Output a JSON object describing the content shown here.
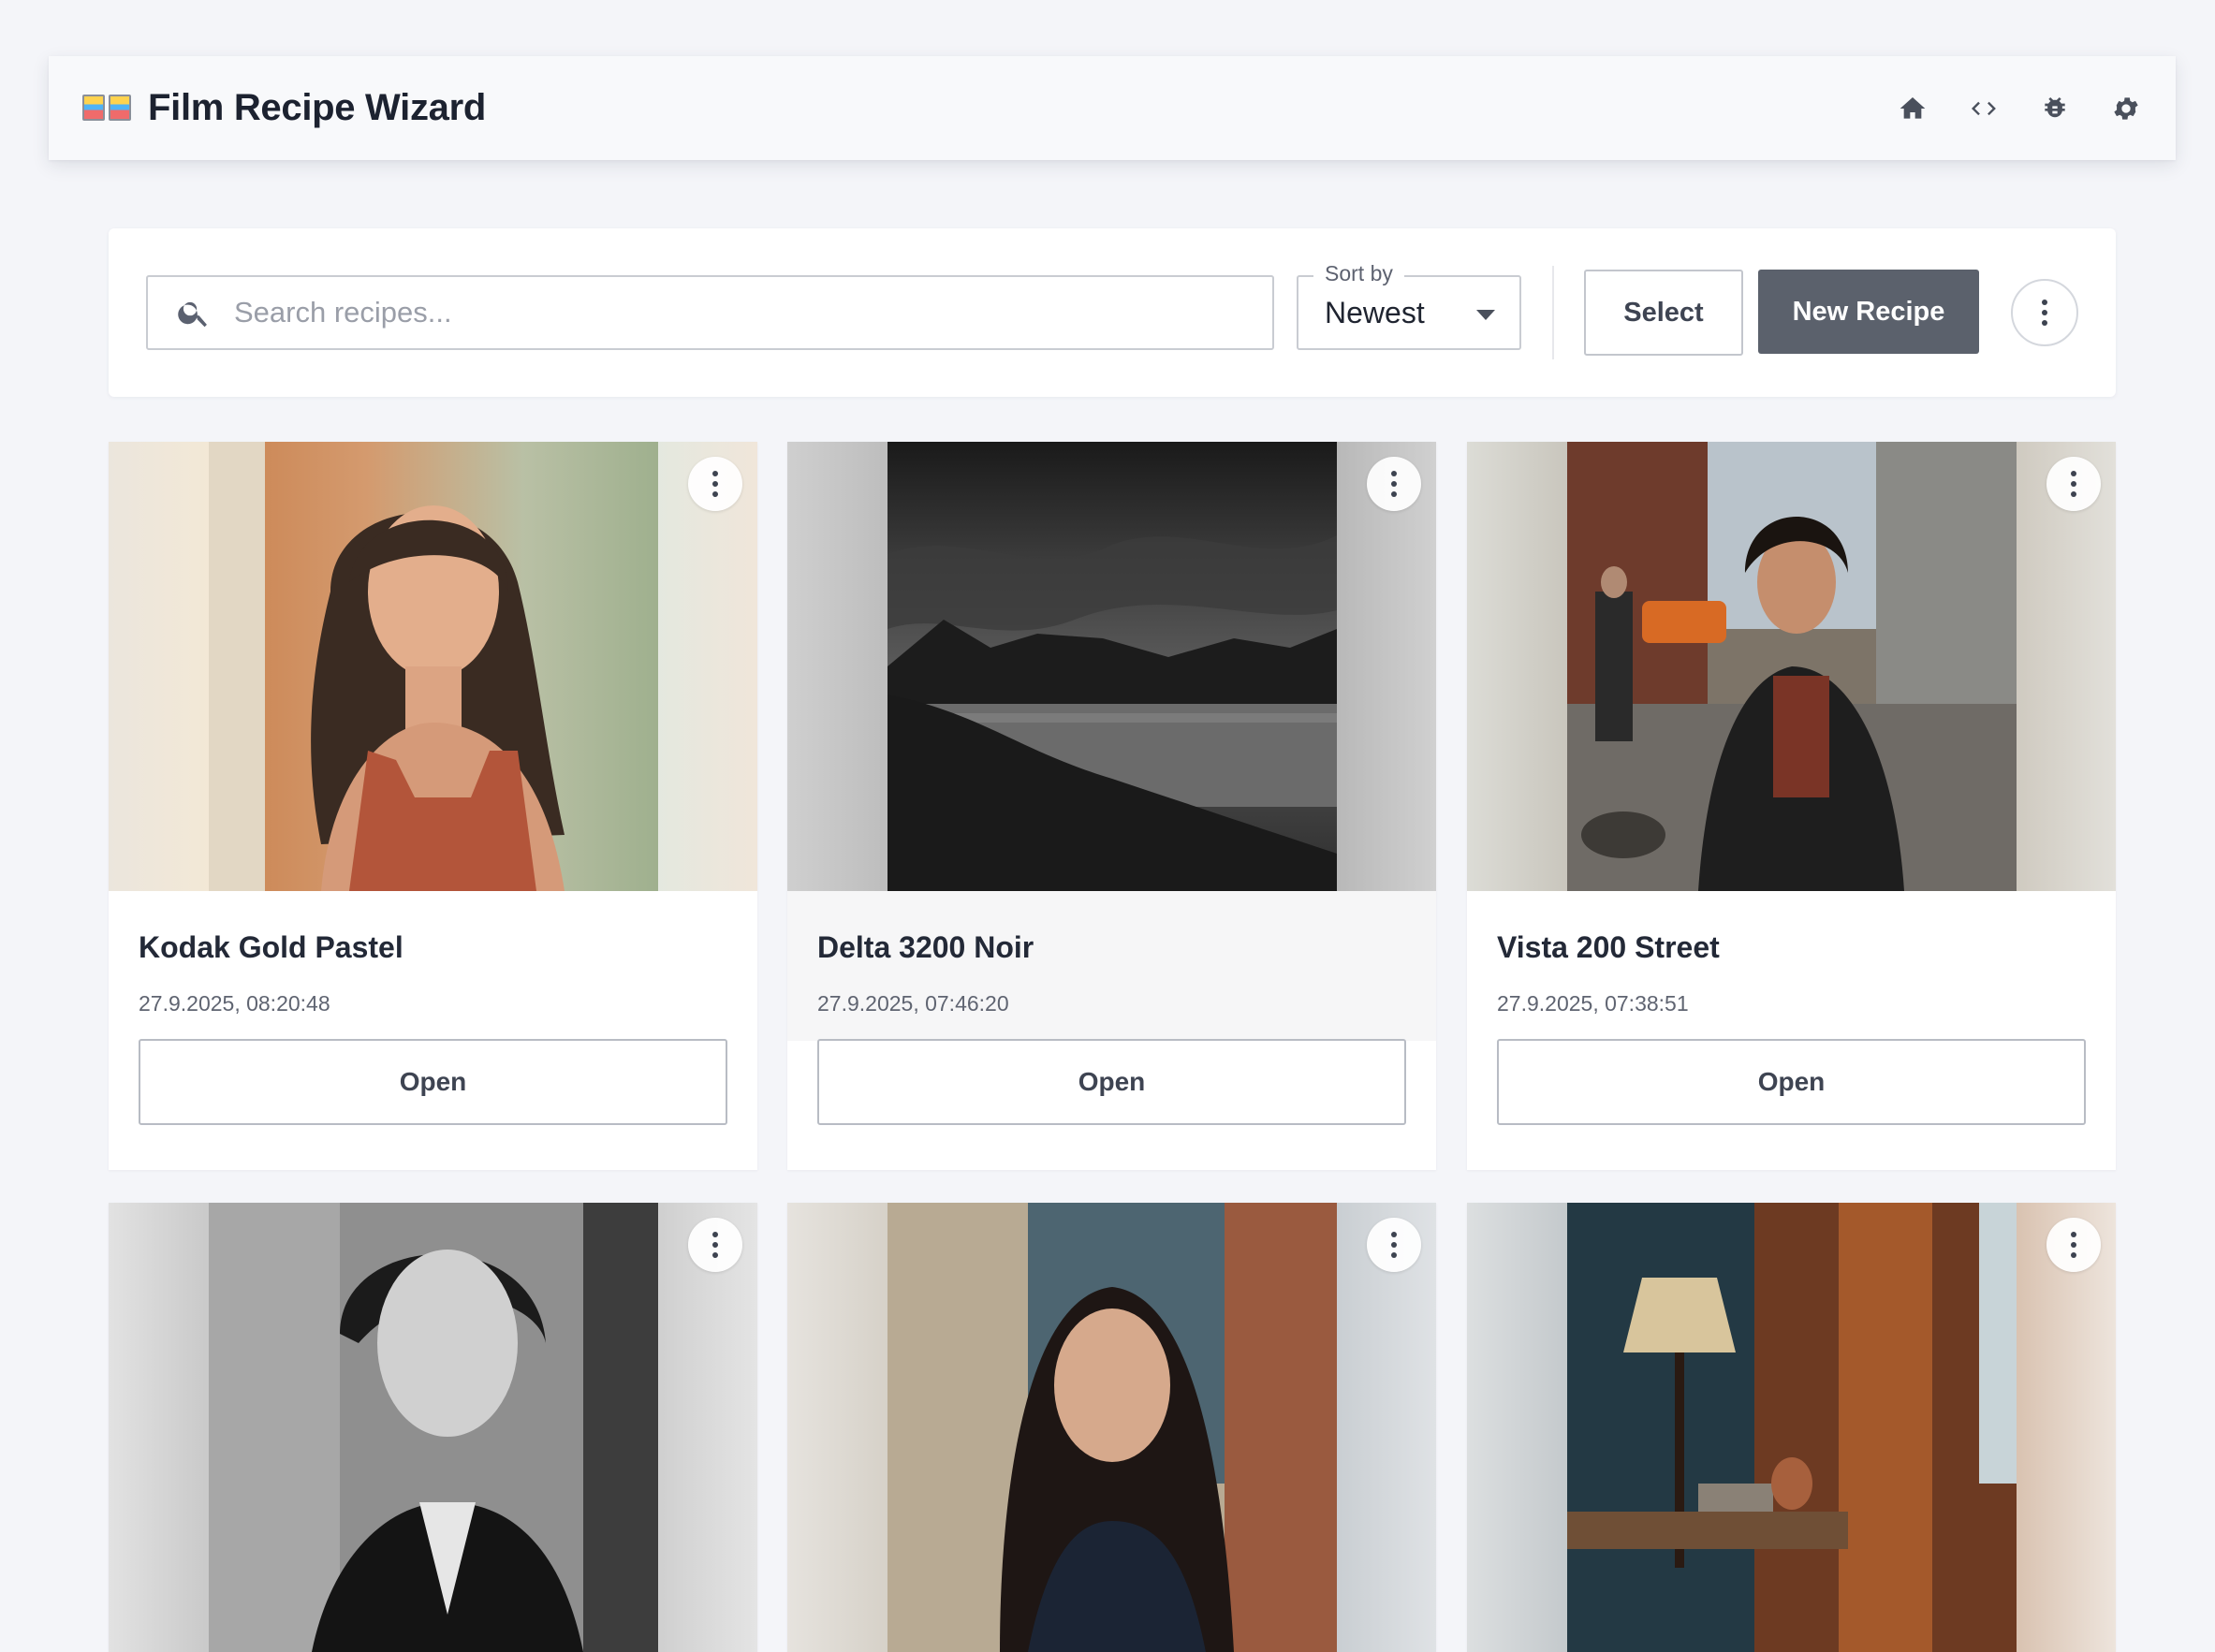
{
  "app": {
    "title": "Film Recipe Wizard",
    "actions": [
      "home-icon",
      "code-icon",
      "bug-icon",
      "gear-icon"
    ]
  },
  "toolbar": {
    "search_placeholder": "Search recipes...",
    "sort_label": "Sort by",
    "sort_value": "Newest",
    "select_label": "Select",
    "new_label": "New Recipe"
  },
  "colors": {
    "primary": "#5b616c",
    "background": "#f4f5f9",
    "card": "#ffffff"
  },
  "cards": [
    {
      "title": "Kodak Gold Pastel",
      "date": "27.9.2025, 08:20:48",
      "open": "Open"
    },
    {
      "title": "Delta 3200 Noir",
      "date": "27.9.2025, 07:46:20",
      "open": "Open"
    },
    {
      "title": "Vista 200 Street",
      "date": "27.9.2025, 07:38:51",
      "open": "Open"
    },
    {
      "title": "",
      "date": "",
      "open": ""
    },
    {
      "title": "",
      "date": "",
      "open": ""
    },
    {
      "title": "",
      "date": "",
      "open": ""
    }
  ]
}
